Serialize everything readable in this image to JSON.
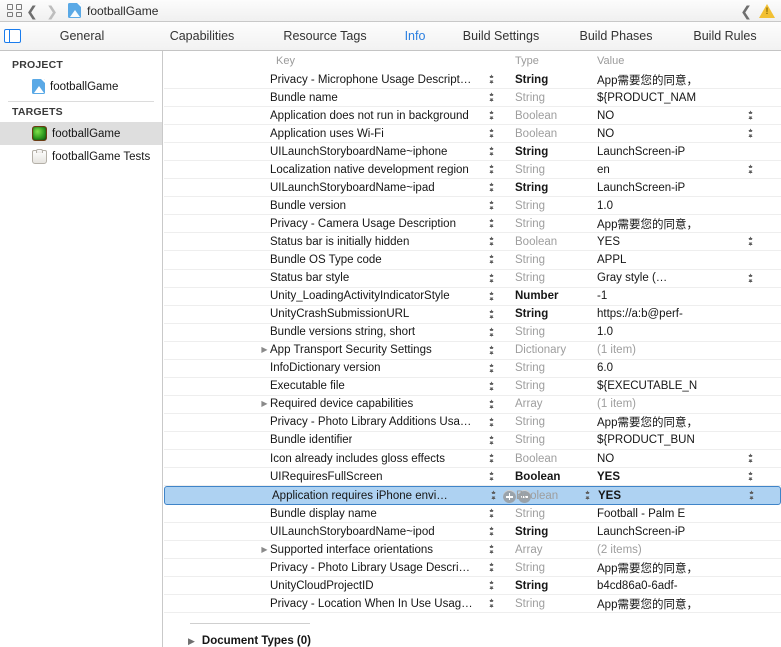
{
  "toolbar": {
    "grid_icon": "grid-icon",
    "back_icon": "chevron-left-icon",
    "forward_icon": "chevron-right-icon",
    "project_icon": "xcode-project-icon",
    "title": "footballGame",
    "right_back_icon": "chevron-left-icon",
    "warning_icon": "warning-triangle-icon"
  },
  "tabbar": {
    "panel_toggle_icon": "navigator-toggle-icon",
    "tabs": [
      {
        "label": "General",
        "active": false
      },
      {
        "label": "Capabilities",
        "active": false
      },
      {
        "label": "Resource Tags",
        "active": false
      },
      {
        "label": "Info",
        "active": true
      },
      {
        "label": "Build Settings",
        "active": false
      },
      {
        "label": "Build Phases",
        "active": false
      },
      {
        "label": "Build Rules",
        "active": false
      }
    ]
  },
  "sidebar": {
    "project_header": "PROJECT",
    "project_items": [
      {
        "label": "footballGame",
        "icon": "project-file-icon",
        "selected": false
      }
    ],
    "targets_header": "TARGETS",
    "target_items": [
      {
        "label": "footballGame",
        "icon": "app-target-icon",
        "selected": true
      },
      {
        "label": "footballGame Tests",
        "icon": "test-bundle-icon",
        "selected": false
      }
    ]
  },
  "plist": {
    "columns": {
      "key": "Key",
      "type": "Type",
      "value": "Value"
    },
    "rows": [
      {
        "key": "Privacy - Microphone Usage Descript…",
        "type": "String",
        "type_bold": true,
        "value": "App需要您的同意，",
        "value_bold": false,
        "value_dim": false,
        "disclosure": false,
        "value_stepper": false
      },
      {
        "key": "Bundle name",
        "type": "String",
        "type_bold": false,
        "value": "${PRODUCT_NAM",
        "value_bold": false,
        "value_dim": false,
        "disclosure": false,
        "value_stepper": false
      },
      {
        "key": "Application does not run in background",
        "type": "Boolean",
        "type_bold": false,
        "value": "NO",
        "value_bold": false,
        "value_dim": false,
        "disclosure": false,
        "value_stepper": true
      },
      {
        "key": "Application uses Wi-Fi",
        "type": "Boolean",
        "type_bold": false,
        "value": "NO",
        "value_bold": false,
        "value_dim": false,
        "disclosure": false,
        "value_stepper": true
      },
      {
        "key": "UILaunchStoryboardName~iphone",
        "type": "String",
        "type_bold": true,
        "value": "LaunchScreen-iP",
        "value_bold": false,
        "value_dim": false,
        "disclosure": false,
        "value_stepper": false
      },
      {
        "key": "Localization native development region",
        "type": "String",
        "type_bold": false,
        "value": "en",
        "value_bold": false,
        "value_dim": false,
        "disclosure": false,
        "value_stepper": true
      },
      {
        "key": "UILaunchStoryboardName~ipad",
        "type": "String",
        "type_bold": true,
        "value": "LaunchScreen-iP",
        "value_bold": false,
        "value_dim": false,
        "disclosure": false,
        "value_stepper": false
      },
      {
        "key": "Bundle version",
        "type": "String",
        "type_bold": false,
        "value": "1.0",
        "value_bold": false,
        "value_dim": false,
        "disclosure": false,
        "value_stepper": false
      },
      {
        "key": "Privacy - Camera Usage Description",
        "type": "String",
        "type_bold": false,
        "value": "App需要您的同意，",
        "value_bold": false,
        "value_dim": false,
        "disclosure": false,
        "value_stepper": false
      },
      {
        "key": "Status bar is initially hidden",
        "type": "Boolean",
        "type_bold": false,
        "value": "YES",
        "value_bold": false,
        "value_dim": false,
        "disclosure": false,
        "value_stepper": true
      },
      {
        "key": "Bundle OS Type code",
        "type": "String",
        "type_bold": false,
        "value": "APPL",
        "value_bold": false,
        "value_dim": false,
        "disclosure": false,
        "value_stepper": false
      },
      {
        "key": "Status bar style",
        "type": "String",
        "type_bold": false,
        "value": "Gray style (…",
        "value_bold": false,
        "value_dim": false,
        "disclosure": false,
        "value_stepper": true
      },
      {
        "key": "Unity_LoadingActivityIndicatorStyle",
        "type": "Number",
        "type_bold": true,
        "value": "-1",
        "value_bold": false,
        "value_dim": false,
        "disclosure": false,
        "value_stepper": false
      },
      {
        "key": "UnityCrashSubmissionURL",
        "type": "String",
        "type_bold": true,
        "value": "https://a:b@perf-",
        "value_bold": false,
        "value_dim": false,
        "disclosure": false,
        "value_stepper": false
      },
      {
        "key": "Bundle versions string, short",
        "type": "String",
        "type_bold": false,
        "value": "1.0",
        "value_bold": false,
        "value_dim": false,
        "disclosure": false,
        "value_stepper": false
      },
      {
        "key": "App Transport Security Settings",
        "type": "Dictionary",
        "type_bold": false,
        "value": "(1 item)",
        "value_bold": false,
        "value_dim": true,
        "disclosure": true,
        "value_stepper": false
      },
      {
        "key": "InfoDictionary version",
        "type": "String",
        "type_bold": false,
        "value": "6.0",
        "value_bold": false,
        "value_dim": false,
        "disclosure": false,
        "value_stepper": false
      },
      {
        "key": "Executable file",
        "type": "String",
        "type_bold": false,
        "value": "${EXECUTABLE_N",
        "value_bold": false,
        "value_dim": false,
        "disclosure": false,
        "value_stepper": false
      },
      {
        "key": "Required device capabilities",
        "type": "Array",
        "type_bold": false,
        "value": "(1 item)",
        "value_bold": false,
        "value_dim": true,
        "disclosure": true,
        "value_stepper": false
      },
      {
        "key": "Privacy - Photo Library Additions Usa…",
        "type": "String",
        "type_bold": false,
        "value": "App需要您的同意，",
        "value_bold": false,
        "value_dim": false,
        "disclosure": false,
        "value_stepper": false
      },
      {
        "key": "Bundle identifier",
        "type": "String",
        "type_bold": false,
        "value": "${PRODUCT_BUN",
        "value_bold": false,
        "value_dim": false,
        "disclosure": false,
        "value_stepper": false
      },
      {
        "key": "Icon already includes gloss effects",
        "type": "Boolean",
        "type_bold": false,
        "value": "NO",
        "value_bold": false,
        "value_dim": false,
        "disclosure": false,
        "value_stepper": true
      },
      {
        "key": "UIRequiresFullScreen",
        "type": "Boolean",
        "type_bold": true,
        "value": "YES",
        "value_bold": true,
        "value_dim": false,
        "disclosure": false,
        "value_stepper": true
      },
      {
        "key": "Application requires iPhone envi…",
        "type": "Boolean",
        "type_bold": false,
        "value": "YES",
        "value_bold": true,
        "value_dim": false,
        "disclosure": false,
        "value_stepper": true,
        "selected": true
      },
      {
        "key": "Bundle display name",
        "type": "String",
        "type_bold": false,
        "value": "Football - Palm E",
        "value_bold": false,
        "value_dim": false,
        "disclosure": false,
        "value_stepper": false
      },
      {
        "key": "UILaunchStoryboardName~ipod",
        "type": "String",
        "type_bold": true,
        "value": "LaunchScreen-iP",
        "value_bold": false,
        "value_dim": false,
        "disclosure": false,
        "value_stepper": false
      },
      {
        "key": "Supported interface orientations",
        "type": "Array",
        "type_bold": false,
        "value": "(2 items)",
        "value_bold": false,
        "value_dim": true,
        "disclosure": true,
        "value_stepper": false
      },
      {
        "key": "Privacy - Photo Library Usage Descri…",
        "type": "String",
        "type_bold": false,
        "value": "App需要您的同意，",
        "value_bold": false,
        "value_dim": false,
        "disclosure": false,
        "value_stepper": false
      },
      {
        "key": "UnityCloudProjectID",
        "type": "String",
        "type_bold": true,
        "value": "b4cd86a0-6adf-",
        "value_bold": false,
        "value_dim": false,
        "disclosure": false,
        "value_stepper": false
      },
      {
        "key": "Privacy - Location When In Use Usag…",
        "type": "String",
        "type_bold": false,
        "value": "App需要您的同意，",
        "value_bold": false,
        "value_dim": false,
        "disclosure": false,
        "value_stepper": false
      }
    ],
    "selected_row_index": 23,
    "selected_row_add_icon": "add-row-icon",
    "selected_row_remove_icon": "remove-row-icon"
  },
  "document_types": {
    "disclosure_icon": "disclosure-triangle-icon",
    "label": "Document Types (0)"
  },
  "colors": {
    "accent": "#2b7fe0",
    "selection": "#aed2f2",
    "selection_border": "#3f84c8",
    "warning": "#f2c033"
  }
}
